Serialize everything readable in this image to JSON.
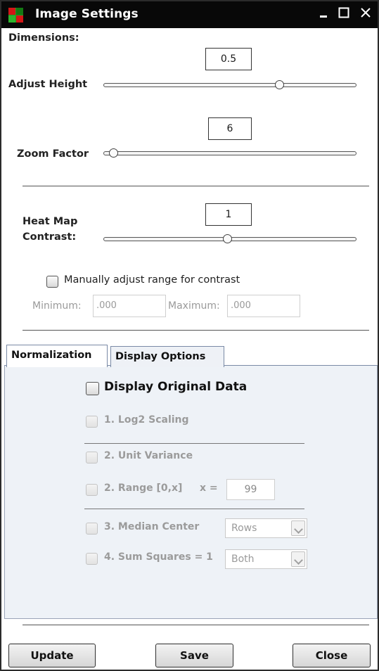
{
  "window": {
    "title": "Image Settings",
    "controls": [
      "minimize-icon",
      "maximize-icon",
      "close-icon"
    ],
    "colors": {
      "titlebar": "#080808",
      "icon_green": "#1f9a1f",
      "icon_red": "#d31616",
      "tab_border": "#7a8aa6",
      "panel_bg": "#eef2f7"
    }
  },
  "dimensions": {
    "heading": "Dimensions:",
    "height": {
      "label": "Adjust Height",
      "value": "0.5",
      "slider_fraction": 0.695
    },
    "zoom": {
      "label": "Zoom Factor",
      "value": "6",
      "slider_fraction": 0.04
    }
  },
  "contrast": {
    "label_line1": "Heat Map",
    "label_line2": "Contrast:",
    "value": "1",
    "slider_fraction": 0.49,
    "manual_label": "Manually adjust range for contrast",
    "manual_checked": false,
    "min_label": "Minimum:",
    "min_value": ".000",
    "max_label": "Maximum:",
    "max_value": ".000"
  },
  "tabs": [
    {
      "label": "Normalization",
      "active": true
    },
    {
      "label": "Display Options",
      "active": false
    }
  ],
  "normalization": {
    "display_original": "Display Original Data",
    "log2": "1. Log2 Scaling",
    "unit_variance": "2. Unit Variance",
    "range": "2. Range [0,x]",
    "range_x_label": "x =",
    "range_x_value": "99",
    "median_center": "3. Median Center",
    "median_option": "Rows",
    "sum_squares": "4. Sum Squares = 1",
    "sum_option": "Both"
  },
  "buttons": {
    "update": "Update",
    "save": "Save",
    "close": "Close"
  }
}
